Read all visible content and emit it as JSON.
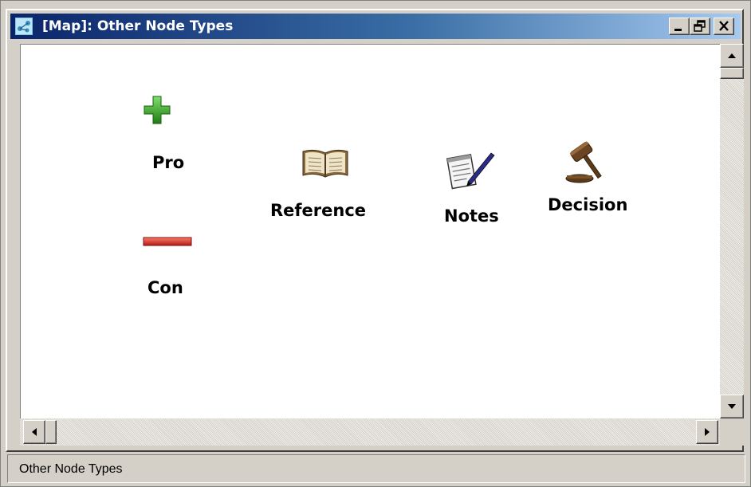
{
  "window": {
    "title": "[Map]: Other Node Types",
    "title_bar_color": "#0a246a",
    "controls": {
      "minimize": "minimize-icon",
      "restore": "restore-icon",
      "close": "close-icon"
    }
  },
  "map": {
    "background": "#ffffff",
    "nodes": [
      {
        "label": "Pro",
        "icon": "plus-icon",
        "color": "#2e9a1e"
      },
      {
        "label": "Con",
        "icon": "minus-icon",
        "color": "#c62828"
      },
      {
        "label": "Reference",
        "icon": "book-icon",
        "color": "#8b6b3d"
      },
      {
        "label": "Notes",
        "icon": "notepad-pen-icon",
        "color": "#555555"
      },
      {
        "label": "Decision",
        "icon": "gavel-icon",
        "color": "#5a3a1a"
      }
    ]
  },
  "status_bar": {
    "text": "Other Node Types"
  }
}
